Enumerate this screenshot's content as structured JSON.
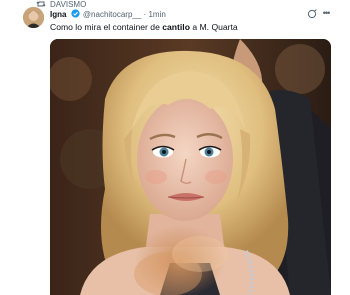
{
  "repost": {
    "label": "DAVISMO",
    "icon": "repost-icon"
  },
  "tweet": {
    "display_name": "Igna",
    "handle": "@nachitocarp__",
    "separator": "·",
    "time": "1min",
    "text_before": "Como lo mira el container de ",
    "text_bold": "cantilo",
    "text_after": " a M. Quarta"
  },
  "colors": {
    "accent": "#1d9bf0",
    "secondary_text": "#536471"
  }
}
